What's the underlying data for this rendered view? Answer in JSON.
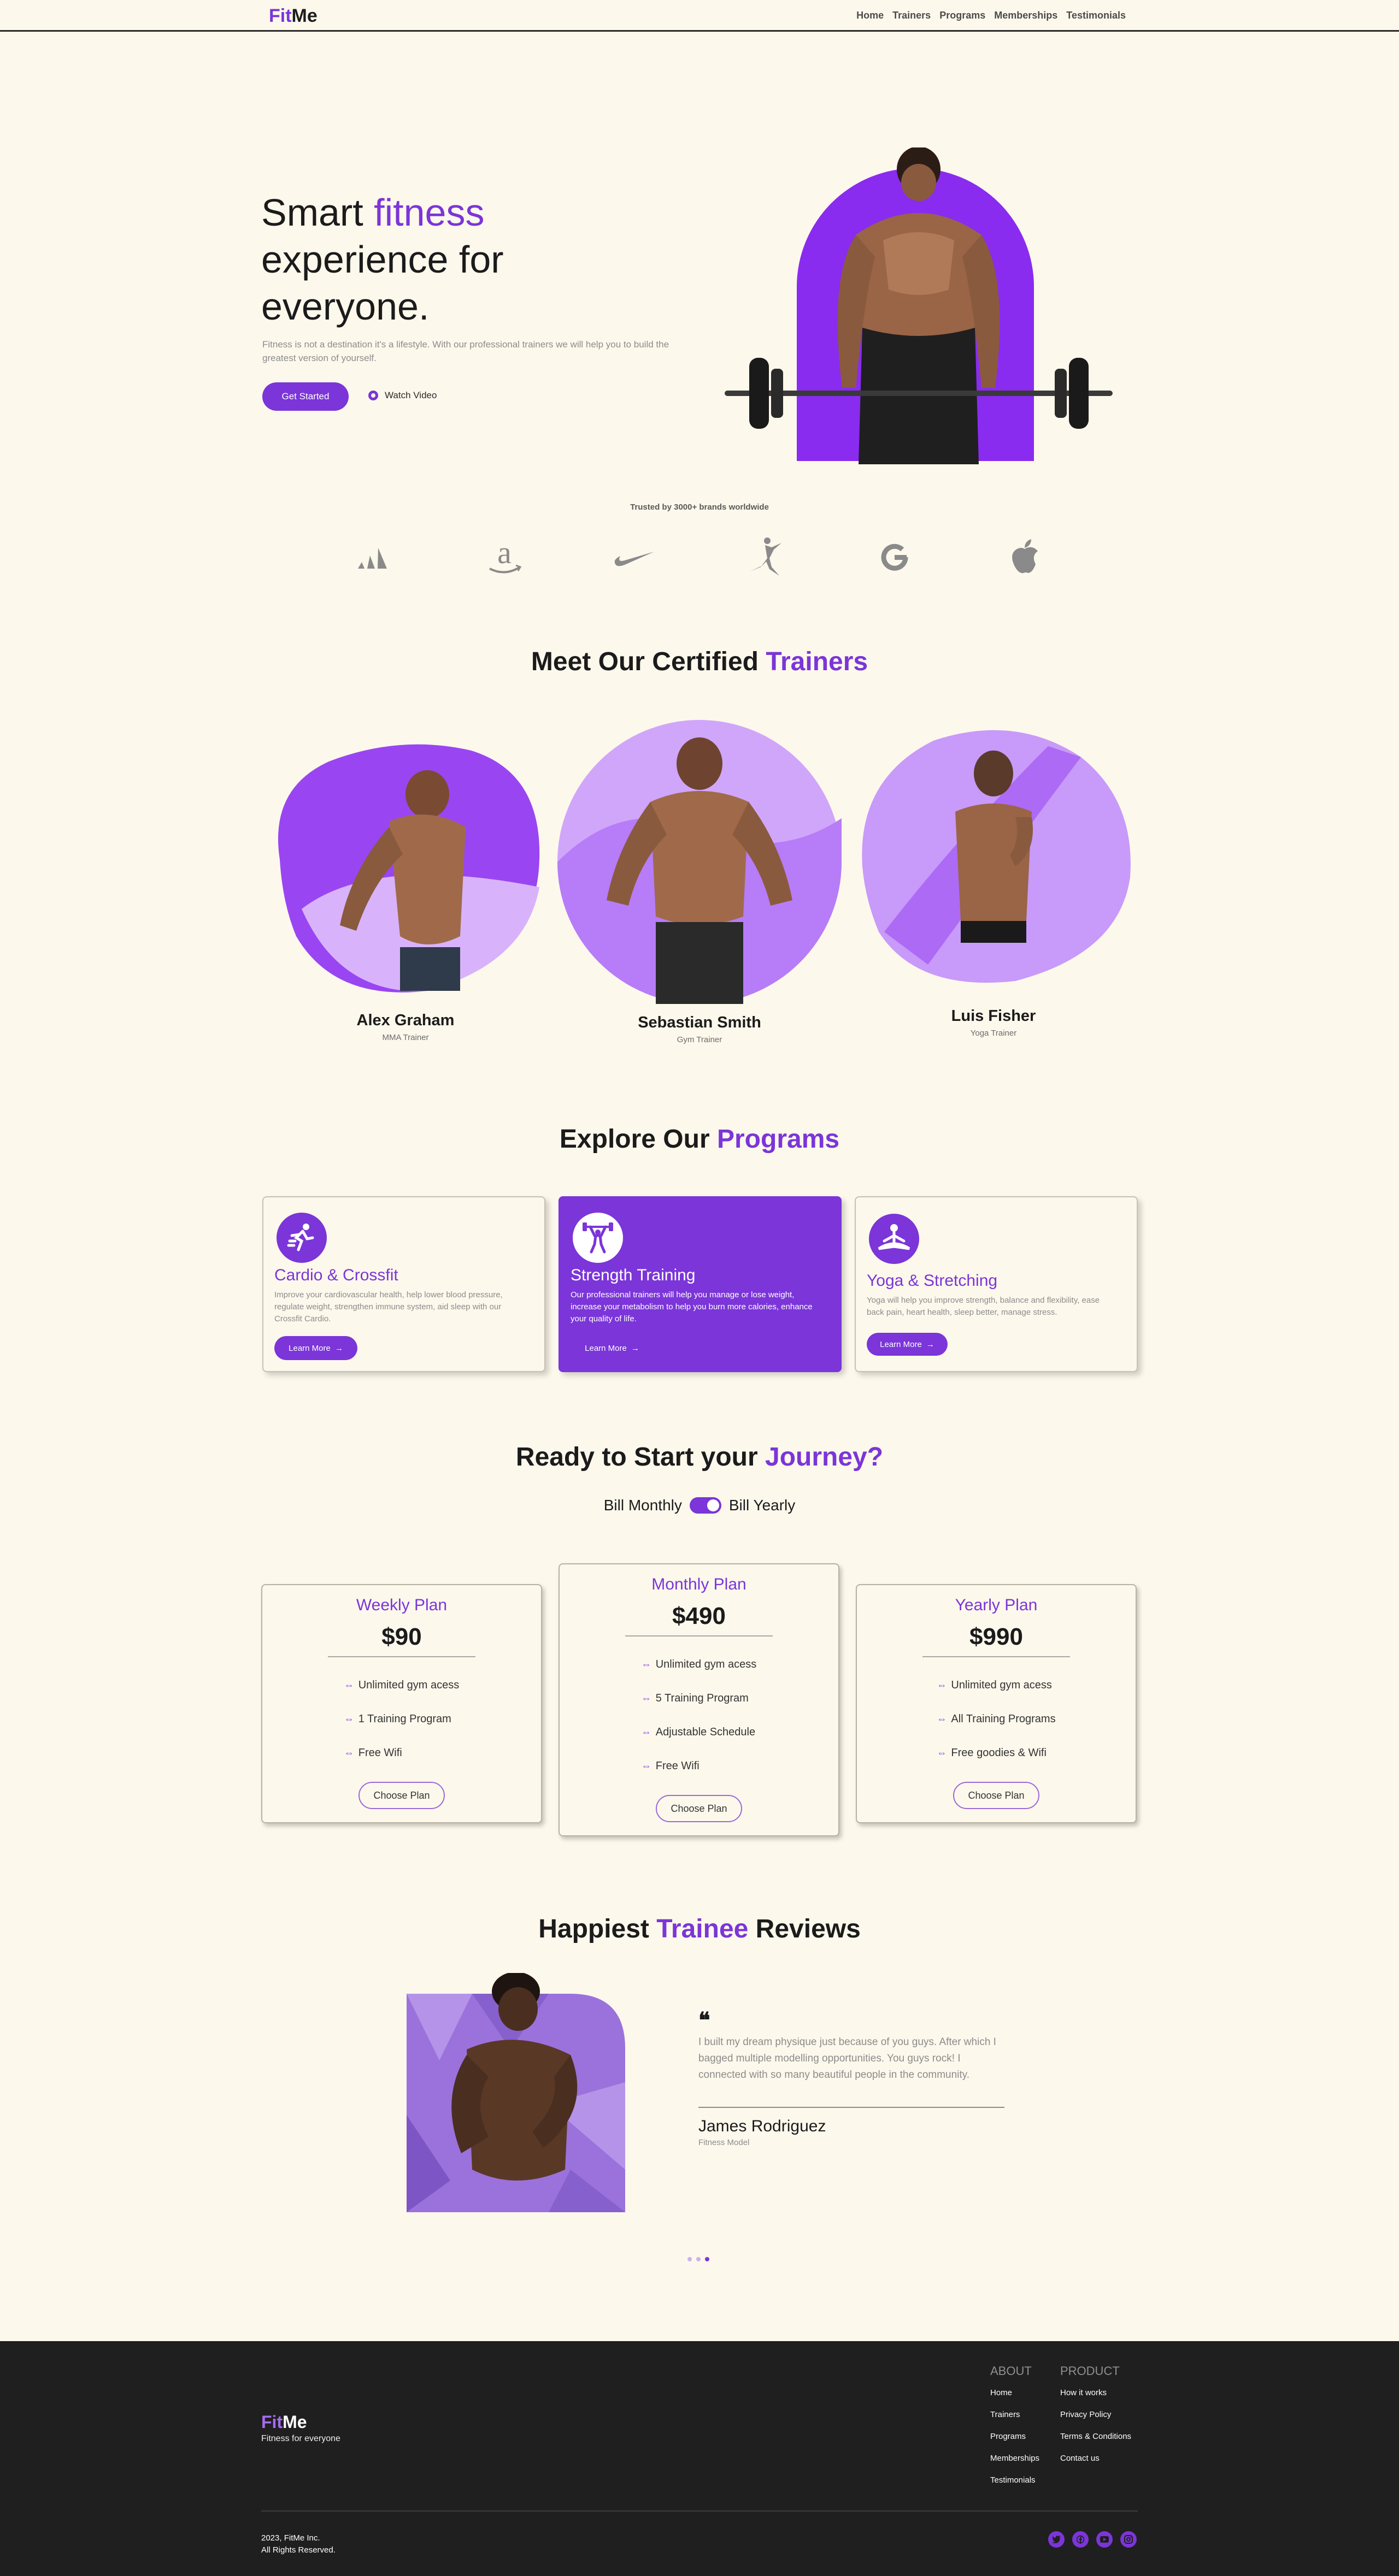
{
  "nav": {
    "logo_fit": "Fit",
    "logo_me": "Me",
    "links": [
      "Home",
      "Trainers",
      "Programs",
      "Memberships",
      "Testimonials"
    ]
  },
  "hero": {
    "title_1": "Smart ",
    "title_highlight": "fitness",
    "title_2": "experience for everyone.",
    "subtitle": "Fitness is not a destination it's a lifestyle. With our professional trainers we will help you to build the greatest version of yourself.",
    "cta": "Get Started",
    "watch": "Watch Video"
  },
  "brands": {
    "trusted": "Trusted by 3000+ brands worldwide",
    "logos": [
      "adidas-logo",
      "amazon-logo",
      "nike-logo",
      "jordan-logo",
      "google-logo",
      "apple-logo"
    ]
  },
  "trainers": {
    "title_1": "Meet Our Certified ",
    "title_highlight": "Trainers",
    "items": [
      {
        "name": "Alex Graham",
        "role": "MMA Trainer"
      },
      {
        "name": "Sebastian Smith",
        "role": "Gym Trainer"
      },
      {
        "name": "Luis Fisher",
        "role": "Yoga Trainer"
      }
    ]
  },
  "programs": {
    "title_1": "Explore Our ",
    "title_highlight": "Programs",
    "items": [
      {
        "title": "Cardio & Crossfit",
        "desc": "Improve your cardiovascular health, help lower blood pressure, regulate weight, strengthen immune system, aid sleep with our Crossfit Cardio.",
        "button": "Learn More",
        "icon": "running-icon"
      },
      {
        "title": "Strength Training",
        "desc": "Our professional trainers will help you manage or lose weight, increase your metabolism to help you burn more calories, enhance your quality of life.",
        "button": "Learn More",
        "icon": "weightlifter-icon"
      },
      {
        "title": "Yoga & Stretching",
        "desc": "Yoga will help you improve strength, balance and flexibility, ease back pain, heart health, sleep better, manage stress.",
        "button": "Learn More",
        "icon": "yoga-icon"
      }
    ]
  },
  "pricing": {
    "title_1": "Ready to Start your ",
    "title_highlight": "Journey?",
    "bill_monthly": "Bill Monthly",
    "bill_yearly": "Bill Yearly",
    "plans": [
      {
        "name": "Weekly Plan",
        "price": "$90",
        "features": [
          "Unlimited gym acess",
          "1 Training Program",
          "Free Wifi"
        ],
        "button": "Choose Plan"
      },
      {
        "name": "Monthly Plan",
        "price": "$490",
        "features": [
          "Unlimited gym acess",
          "5 Training Program",
          "Adjustable Schedule",
          "Free Wifi"
        ],
        "button": "Choose Plan"
      },
      {
        "name": "Yearly Plan",
        "price": "$990",
        "features": [
          "Unlimited gym acess",
          "All Training Programs",
          "Free goodies & Wifi"
        ],
        "button": "Choose Plan"
      }
    ]
  },
  "reviews": {
    "title_1": "Happiest ",
    "title_highlight": "Trainee",
    "title_2": " Reviews",
    "quote_mark": "❝",
    "text": "I built my dream physique just because of you guys. After which I bagged multiple modelling opportunities. You guys rock! I connected with so many beautiful people in the community.",
    "name": "James Rodriguez",
    "role": "Fitness Model"
  },
  "footer": {
    "logo_fit": "Fit",
    "logo_me": "Me",
    "tagline": "Fitness for everyone",
    "about_heading": "ABOUT",
    "about_links": [
      "Home",
      "Trainers",
      "Programs",
      "Memberships",
      "Testimonials"
    ],
    "product_heading": "PRODUCT",
    "product_links": [
      "How it works",
      "Privacy Policy",
      "Terms & Conditions",
      "Contact us"
    ],
    "copyright_1": "2023, FitMe Inc.",
    "copyright_2": "All Rights Reserved.",
    "socials": [
      "twitter-icon",
      "facebook-icon",
      "youtube-icon",
      "instagram-icon"
    ]
  },
  "colors": {
    "accent": "#7b35d8",
    "background": "#fdf8ec",
    "footer": "#1f1f1f"
  }
}
